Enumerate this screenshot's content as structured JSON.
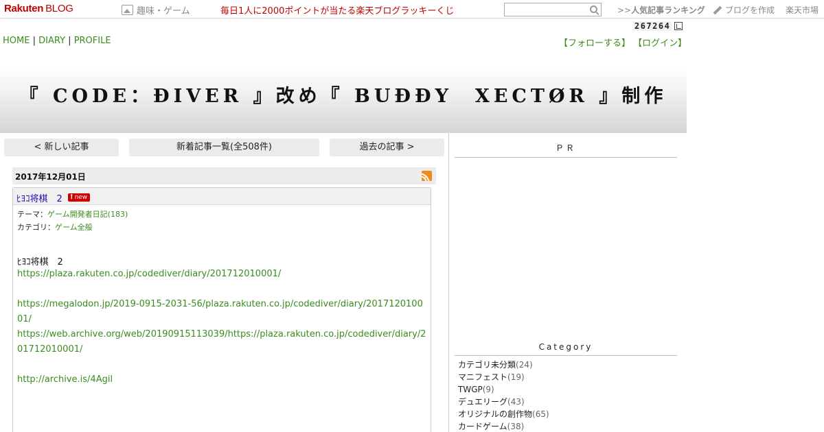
{
  "topbar": {
    "logo_brand": "Rakuten",
    "logo_sub": "BLOG",
    "genre_label": "趣味・ゲーム",
    "lucky_text": "毎日1人に2000ポイントが当たる楽天ブログラッキーくじ",
    "search_value": "",
    "ranking_prefix": ">>",
    "ranking_label": "人気記事ランキング",
    "create_label": "ブログを作成",
    "market_label": "楽天市場"
  },
  "counter": {
    "value": "267264"
  },
  "nav": {
    "home": "HOME",
    "diary": "DIARY",
    "profile": "PROFILE",
    "sep": "|"
  },
  "account": {
    "follow": "【フォローする】",
    "login": "【ログイン】"
  },
  "blog": {
    "title": "『 CODE：ÐIVER 』改め『 BUĐĐY　XECTØR 』制作"
  },
  "pager": {
    "newer": "< 新しい記事",
    "list": "新着記事一覧(全508件)",
    "older": "過去の記事 >"
  },
  "entry": {
    "date": "2017年12月01日",
    "title": "ﾋﾖｺ将棋　2",
    "badge": "new",
    "theme_label": "テーマ：",
    "theme_value": "ゲーム開発者日記(183)",
    "category_label": "カテゴリ：",
    "category_value": "ゲーム全般",
    "body_title": "ﾋﾖｺ将棋　2",
    "links": [
      "https://plaza.rakuten.co.jp/codediver/diary/201712010001/",
      "https://megalodon.jp/2019-0915-2031-56/plaza.rakuten.co.jp/codediver/diary/201712010001/",
      "https://web.archive.org/web/20190915113039/https://plaza.rakuten.co.jp/codediver/diary/201712010001/",
      "http://archive.is/4Agil"
    ]
  },
  "sidebar": {
    "pr_heading": "ＰＲ",
    "category_heading": "Category",
    "categories": [
      {
        "name": "カテゴリ未分類",
        "count": "(24)"
      },
      {
        "name": "マニフェスト",
        "count": "(19)"
      },
      {
        "name": "TWGP",
        "count": "(9)"
      },
      {
        "name": "デュエリーグ",
        "count": "(43)"
      },
      {
        "name": "オリジナルの創作物",
        "count": "(65)"
      },
      {
        "name": "カードゲーム",
        "count": "(38)"
      }
    ]
  },
  "colors": {
    "brand_red": "#bf0000",
    "link_green": "#3a8c1e",
    "title_blue": "#1a0dab",
    "rss_orange": "#f08a1e"
  }
}
